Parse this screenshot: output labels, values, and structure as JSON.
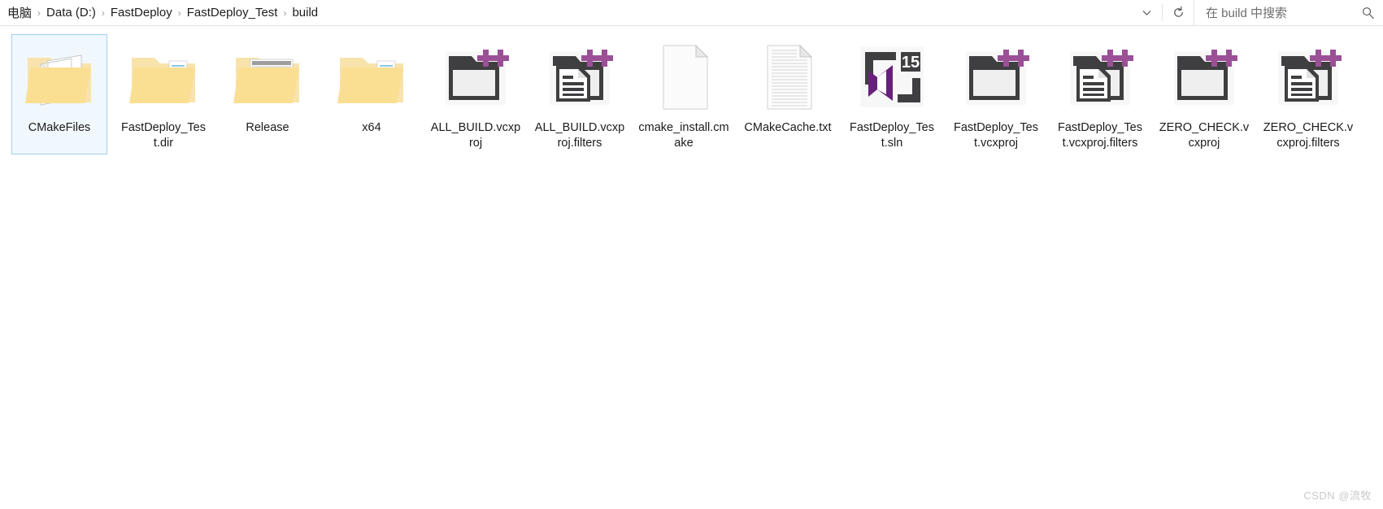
{
  "addressbar": {
    "breadcrumbs": [
      {
        "label": "电脑"
      },
      {
        "label": "Data (D:)"
      },
      {
        "label": "FastDeploy"
      },
      {
        "label": "FastDeploy_Test"
      },
      {
        "label": "build"
      }
    ],
    "separator": "›",
    "dropdown_icon": "chevron-down-icon",
    "refresh_icon": "refresh-icon",
    "search": {
      "placeholder": "在 build 中搜索",
      "value": "",
      "icon": "search-icon"
    }
  },
  "main": {
    "items": [
      {
        "name": "CMakeFiles",
        "icon": "folder-documents-icon",
        "selected": true
      },
      {
        "name": "FastDeploy_Test.dir",
        "icon": "folder-files-icon",
        "selected": false
      },
      {
        "name": "Release",
        "icon": "folder-window-icon",
        "selected": false
      },
      {
        "name": "x64",
        "icon": "folder-files-icon",
        "selected": false
      },
      {
        "name": "ALL_BUILD.vcxproj",
        "icon": "vcxproj-icon",
        "selected": false
      },
      {
        "name": "ALL_BUILD.vcxproj.filters",
        "icon": "vcxproj-filters-icon",
        "selected": false
      },
      {
        "name": "cmake_install.cmake",
        "icon": "generic-file-icon",
        "selected": false
      },
      {
        "name": "CMakeCache.txt",
        "icon": "text-file-icon",
        "selected": false
      },
      {
        "name": "FastDeploy_Test.sln",
        "icon": "visual-studio-sln-icon",
        "selected": false
      },
      {
        "name": "FastDeploy_Test.vcxproj",
        "icon": "vcxproj-icon",
        "selected": false
      },
      {
        "name": "FastDeploy_Test.vcxproj.filters",
        "icon": "vcxproj-filters-icon",
        "selected": false
      },
      {
        "name": "ZERO_CHECK.vcxproj",
        "icon": "vcxproj-icon",
        "selected": false
      },
      {
        "name": "ZERO_CHECK.vcxproj.filters",
        "icon": "vcxproj-filters-icon",
        "selected": false
      }
    ]
  },
  "watermark": {
    "text": "CSDN @流牧"
  },
  "colors": {
    "folder_front": "#fadf93",
    "folder_back": "#f6e4ae",
    "vs_purple": "#68217a",
    "cpp_plus": "#9b4f96",
    "icon_dark": "#3f3f41",
    "selection_border": "#9fd0ef",
    "selection_fill": "#f1f8fd"
  }
}
